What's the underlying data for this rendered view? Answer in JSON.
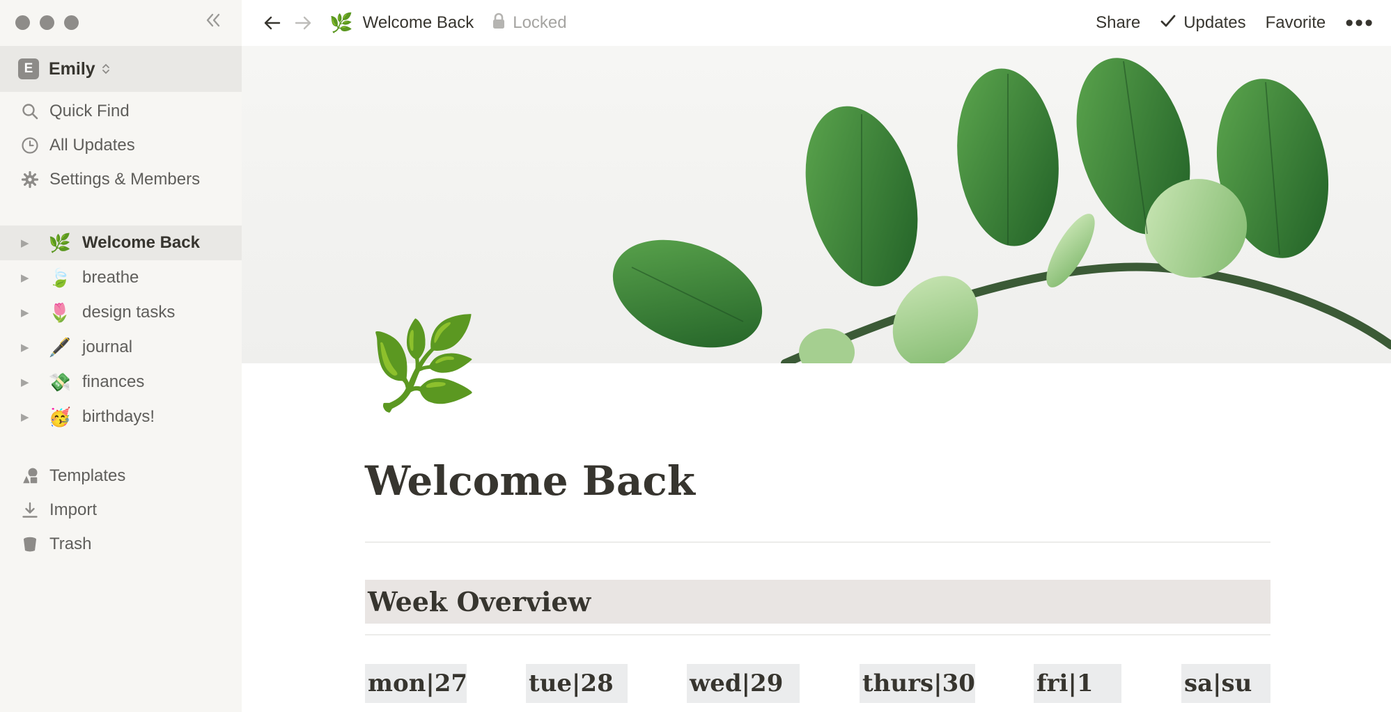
{
  "sidebar": {
    "workspace": {
      "initial": "E",
      "name": "Emily",
      "switch_icon": "chevron-updown-icon"
    },
    "nav": [
      {
        "label": "Quick Find",
        "icon": "search-icon"
      },
      {
        "label": "All Updates",
        "icon": "clock-icon"
      },
      {
        "label": "Settings & Members",
        "icon": "gear-icon"
      }
    ],
    "pages": [
      {
        "emoji": "🌿",
        "label": "Welcome Back",
        "active": true
      },
      {
        "emoji": "🍃",
        "label": "breathe"
      },
      {
        "emoji": "🌷",
        "label": "design tasks"
      },
      {
        "emoji": "🖋️",
        "label": "journal"
      },
      {
        "emoji": "💸",
        "label": "finances"
      },
      {
        "emoji": "🥳",
        "label": "birthdays!"
      }
    ],
    "footer": [
      {
        "label": "Templates",
        "icon": "shapes-icon"
      },
      {
        "label": "Import",
        "icon": "download-icon"
      },
      {
        "label": "Trash",
        "icon": "trash-icon"
      }
    ]
  },
  "topbar": {
    "page_emoji": "🌿",
    "page_title": "Welcome Back",
    "lock_label": "Locked",
    "share_label": "Share",
    "updates_label": "Updates",
    "favorite_label": "Favorite",
    "more_label": "•••"
  },
  "page": {
    "icon": "🌿",
    "title": "Welcome Back",
    "section_heading": "Week Overview",
    "days": [
      "mon|27",
      "tue|28",
      "wed|29",
      "thurs|30",
      "fri|1",
      "sa|su"
    ]
  },
  "colors": {
    "sidebar_bg": "#f7f6f3",
    "sidebar_active": "#e9e8e5",
    "heading_bg": "#e9e5e3",
    "day_bg": "#ebeced",
    "text": "#37352f"
  }
}
